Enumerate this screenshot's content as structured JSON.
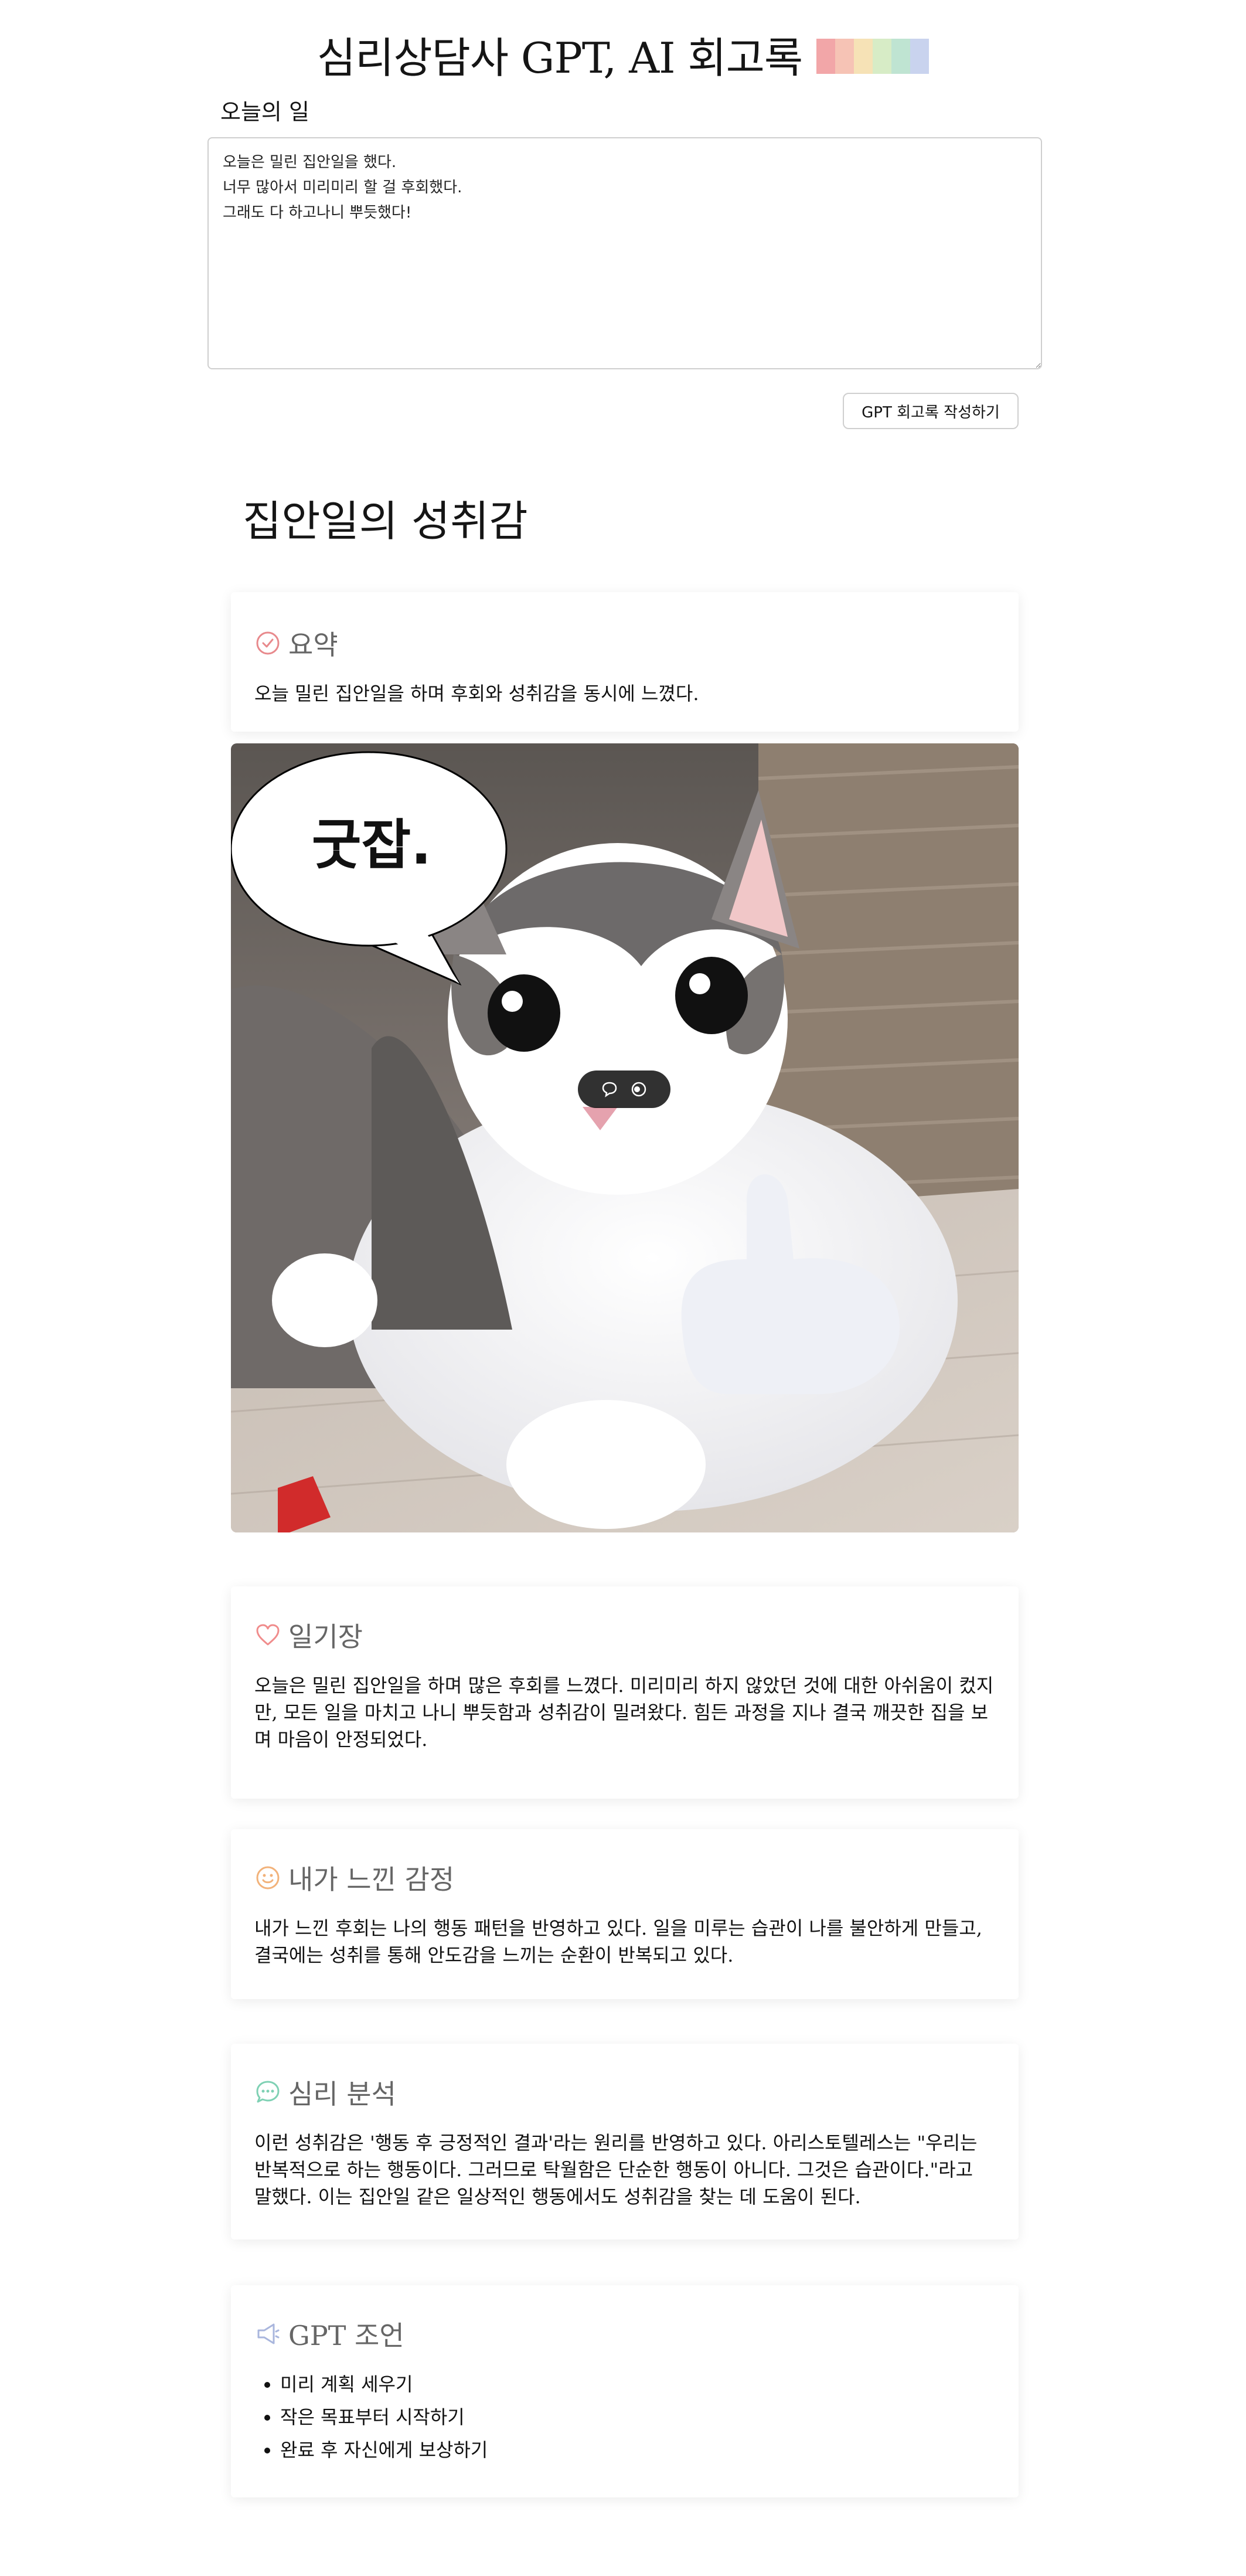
{
  "header": {
    "title": "심리상담사 GPT, AI 회고록",
    "palette": [
      "#f2a6a8",
      "#f6c3b5",
      "#f6e2b6",
      "#d7ecc6",
      "#bfe4d2",
      "#c9d3ee"
    ]
  },
  "input": {
    "label": "오늘의 일",
    "value": "오늘은 밀린 집안일을 했다.\n너무 많아서 미리미리 할 걸 후회했다.\n그래도 다 하고나니 뿌듯했다!",
    "button_label": "GPT 회고록 작성하기"
  },
  "result": {
    "title": "집안일의 성취감",
    "summary": {
      "title": "요약",
      "icon": "check-circle-icon",
      "icon_color": "#e8898c",
      "text": "오늘 밀린 집안일을 하며 후회와 성취감을 동시에 느꼈다."
    },
    "image": {
      "speech_bubble_text": "굿잡.",
      "toolbar_icons": [
        "speech-bubble-icon",
        "toggle-icon"
      ]
    },
    "diary": {
      "title": "일기장",
      "icon": "heart-icon",
      "icon_color": "#f08c8c",
      "text": "오늘은 밀린 집안일을 하며 많은 후회를 느꼈다. 미리미리 하지 않았던 것에 대한 아쉬움이 컸지만, 모든 일을 마치고 나니 뿌듯함과 성취감이 밀려왔다. 힘든 과정을 지나 결국 깨끗한 집을 보며 마음이 안정되었다."
    },
    "emotion": {
      "title": "내가 느낀 감정",
      "icon": "smile-icon",
      "icon_color": "#f2b27a",
      "text": "내가 느낀 후회는 나의 행동 패턴을 반영하고 있다. 일을 미루는 습관이 나를 불안하게 만들고, 결국에는 성취를 통해 안도감을 느끼는 순환이 반복되고 있다."
    },
    "analysis": {
      "title": "심리 분석",
      "icon": "chat-dots-icon",
      "icon_color": "#7fd1b4",
      "text": "이런 성취감은 '행동 후 긍정적인 결과'라는 원리를 반영하고 있다. 아리스토텔레스는 \"우리는 반복적으로 하는 행동이다. 그러므로 탁월함은 단순한 행동이 아니다. 그것은 습관이다.\"라고 말했다. 이는 집안일 같은 일상적인 행동에서도 성취감을 찾는 데 도움이 된다."
    },
    "advice": {
      "title": "GPT 조언",
      "icon": "megaphone-icon",
      "icon_color": "#a9b6dd",
      "items": [
        "미리 계획 세우기",
        "작은 목표부터 시작하기",
        "완료 후 자신에게 보상하기"
      ]
    }
  }
}
